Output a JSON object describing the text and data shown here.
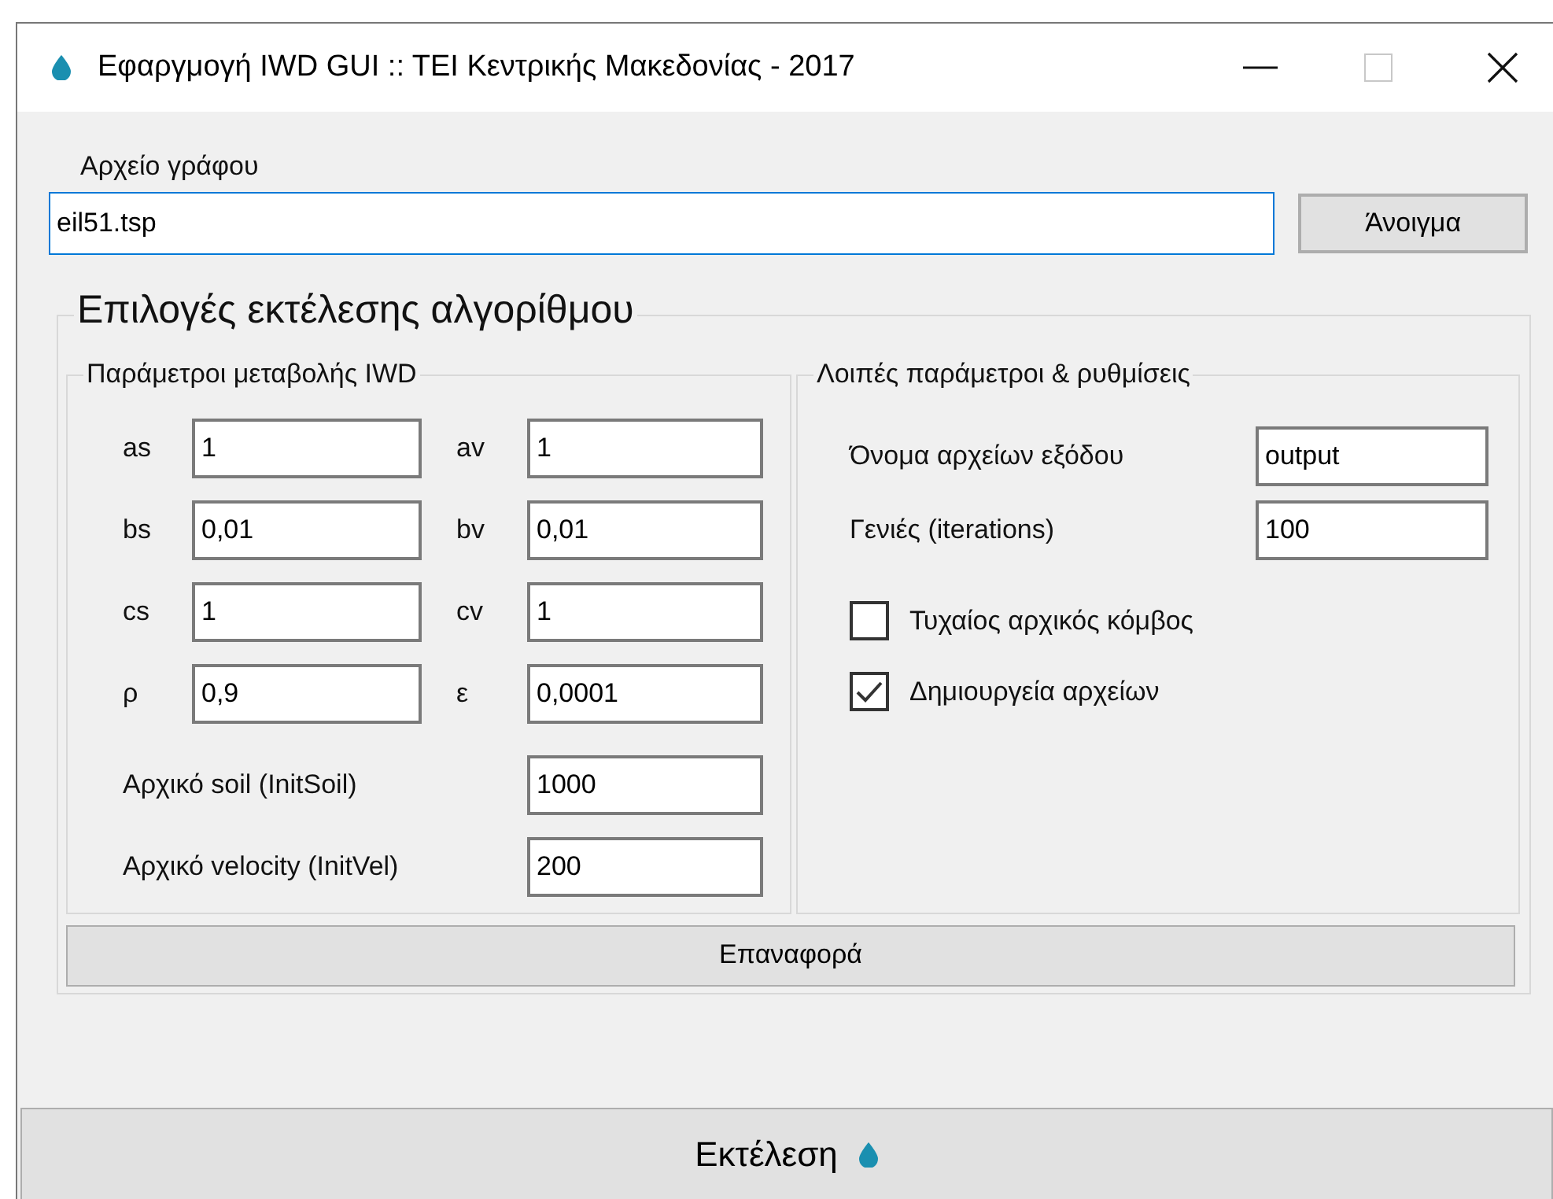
{
  "window": {
    "title": "Εφαργμογή IWD GUI :: TEI Κεντρικής Μακεδονίας - 2017"
  },
  "file": {
    "label": "Αρχείο γράφου",
    "value": "eil51.tsp",
    "button": "Άνοιγμα"
  },
  "options": {
    "title": "Επιλογές εκτέλεσης αλγορίθμου",
    "iwd": {
      "title": "Παράμετροι μεταβολής IWD",
      "pairs": [
        {
          "left": {
            "label": "as",
            "value": "1"
          },
          "right": {
            "label": "av",
            "value": "1"
          }
        },
        {
          "left": {
            "label": "bs",
            "value": "0,01"
          },
          "right": {
            "label": "bv",
            "value": "0,01"
          }
        },
        {
          "left": {
            "label": "cs",
            "value": "1"
          },
          "right": {
            "label": "cv",
            "value": "1"
          }
        },
        {
          "left": {
            "label": "ρ",
            "value": "0,9"
          },
          "right": {
            "label": "ε",
            "value": "0,0001"
          }
        }
      ],
      "wide": [
        {
          "label": "Αρχικό soil (InitSoil)",
          "value": "1000"
        },
        {
          "label": "Αρχικό velocity (InitVel)",
          "value": "200"
        }
      ]
    },
    "other": {
      "title": "Λοιπές παράμετροι & ρυθμίσεις",
      "fields": [
        {
          "label": "Όνομα αρχείων εξόδου",
          "value": "output"
        },
        {
          "label": "Γενιές (iterations)",
          "value": "100"
        }
      ],
      "checkboxes": [
        {
          "label": "Τυχαίος αρχικός κόμβος",
          "checked": false
        },
        {
          "label": "Δημιουργεία αρχείων",
          "checked": true
        }
      ]
    },
    "reset_button": "Επαναφορά"
  },
  "run_button": "Εκτέλεση"
}
